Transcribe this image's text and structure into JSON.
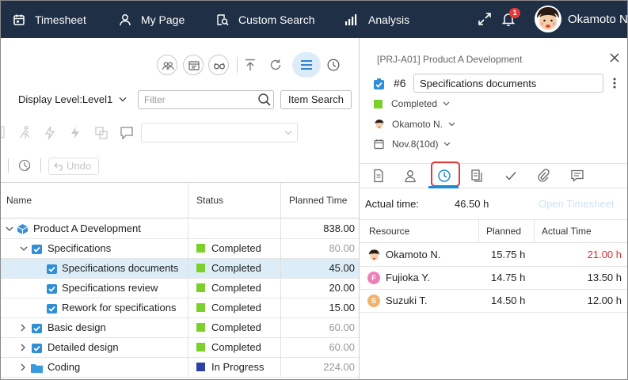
{
  "topnav": {
    "items": [
      {
        "label": "Timesheet",
        "icon": "calendar-icon"
      },
      {
        "label": "My Page",
        "icon": "person-icon"
      },
      {
        "label": "Custom Search",
        "icon": "search-doc-icon"
      },
      {
        "label": "Analysis",
        "icon": "bar-chart-icon"
      }
    ],
    "notification_count": "1",
    "user_name": "Okamoto N"
  },
  "toolbar": {
    "display_level": "Display Level:Level1",
    "filter_placeholder": "Filter",
    "item_search_label": "Item Search",
    "undo_label": "Undo"
  },
  "grid": {
    "headers": {
      "name": "Name",
      "status": "Status",
      "planned_time": "Planned Time"
    },
    "rows": [
      {
        "name": "Product A Development",
        "status": "",
        "status_color": "",
        "time": "838.00",
        "time_color": "#222222",
        "icon": "cube-icon"
      },
      {
        "name": "Specifications",
        "status": "Completed",
        "status_color": "#7cd02b",
        "time": "80.00",
        "time_color": "#9a9a9a",
        "icon": "task-icon"
      },
      {
        "name": "Specifications documents",
        "status": "Completed",
        "status_color": "#7cd02b",
        "time": "45.00",
        "time_color": "#222222",
        "icon": "task-icon"
      },
      {
        "name": "Specifications review",
        "status": "Completed",
        "status_color": "#7cd02b",
        "time": "20.00",
        "time_color": "#222222",
        "icon": "task-icon"
      },
      {
        "name": "Rework for specifications",
        "status": "Completed",
        "status_color": "#7cd02b",
        "time": "15.00",
        "time_color": "#222222",
        "icon": "task-icon"
      },
      {
        "name": "Basic design",
        "status": "Completed",
        "status_color": "#7cd02b",
        "time": "60.00",
        "time_color": "#9a9a9a",
        "icon": "task-icon"
      },
      {
        "name": "Detailed design",
        "status": "Completed",
        "status_color": "#7cd02b",
        "time": "60.00",
        "time_color": "#9a9a9a",
        "icon": "task-icon"
      },
      {
        "name": "Coding",
        "status": "In Progress",
        "status_color": "#2f3fa8",
        "time": "224.00",
        "time_color": "#9a9a9a",
        "icon": "folder-icon"
      }
    ]
  },
  "detail": {
    "project_title": "[PRJ-A01] Product A Development",
    "task_number": "#6",
    "task_name": "Specifications documents",
    "status": "Completed",
    "status_color": "#7cd02b",
    "assignee": "Okamoto N.",
    "due": "Nov.8(10d)",
    "actual_time_label": "Actual time:",
    "actual_time_value": "46.50 h",
    "open_timesheet_label": "Open Timesheet",
    "resource_headers": {
      "resource": "Resource",
      "planned": "Planned",
      "actual": "Actual Time"
    },
    "resources": [
      {
        "name": "Okamoto N.",
        "planned": "15.75 h",
        "actual": "21.00 h",
        "actual_color": "#d32f2f",
        "avatar_letter": "",
        "avatar_color": ""
      },
      {
        "name": "Fujioka Y.",
        "planned": "14.75 h",
        "actual": "13.50 h",
        "actual_color": "#222222",
        "avatar_letter": "F",
        "avatar_color": "#ef7fb8"
      },
      {
        "name": "Suzuki T.",
        "planned": "14.50 h",
        "actual": "12.00 h",
        "actual_color": "#222222",
        "avatar_letter": "S",
        "avatar_color": "#f1b26b"
      }
    ]
  }
}
